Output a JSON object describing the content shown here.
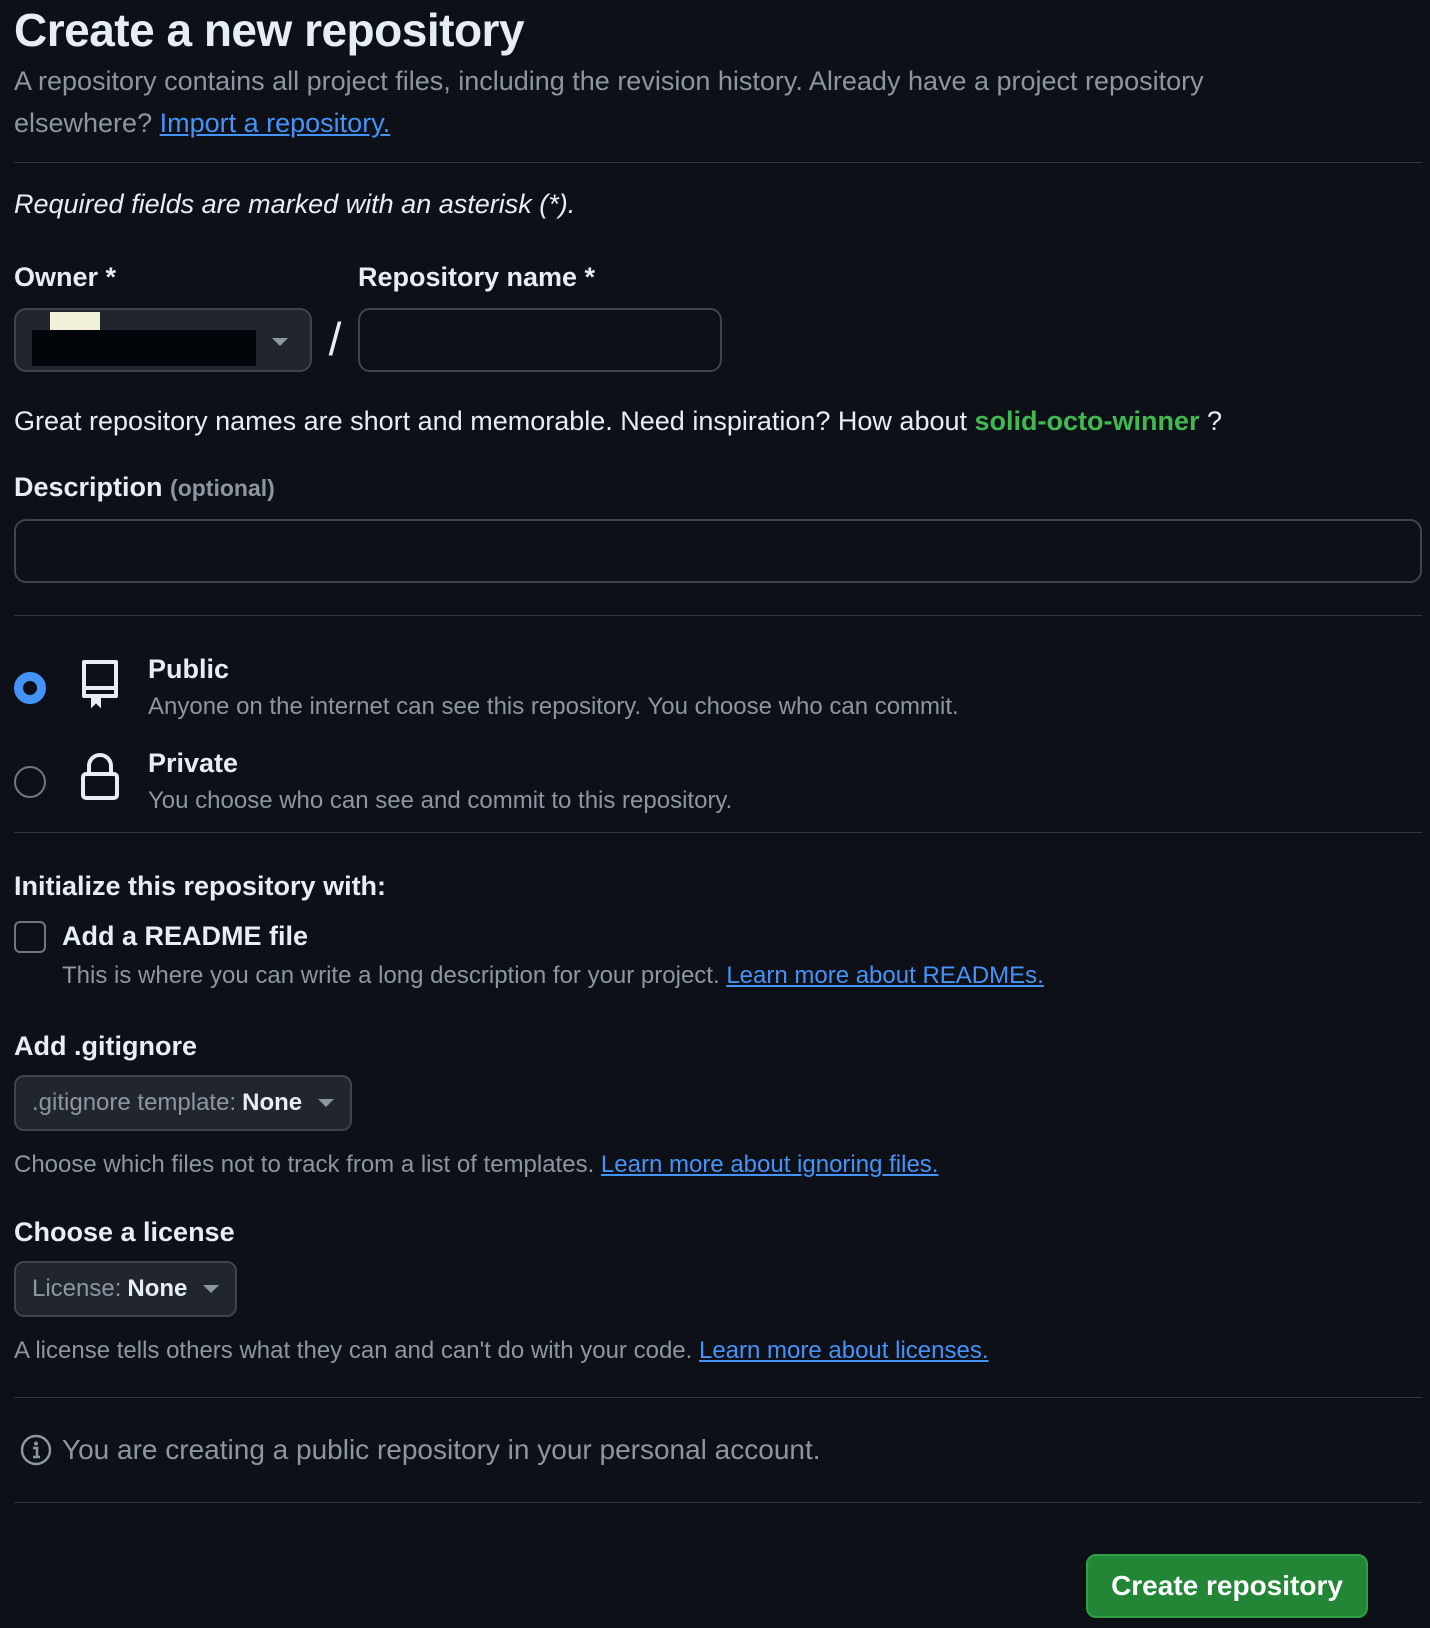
{
  "header": {
    "title": "Create a new repository",
    "subtitle_line1": "A repository contains all project files, including the revision history. Already have a project repository",
    "subtitle_line2": "elsewhere?",
    "import_link": "Import a repository."
  },
  "required_note": "Required fields are marked with an asterisk (*).",
  "owner": {
    "label": "Owner *",
    "icon": "chevron-down-icon"
  },
  "separator": "/",
  "repo_name": {
    "label": "Repository name *",
    "value": "",
    "placeholder": ""
  },
  "inspiration": {
    "text": "Great repository names are short and memorable. Need inspiration? How about",
    "suggestion": "solid-octo-winner",
    "end": "?"
  },
  "description": {
    "label": "Description",
    "optional": "(optional)",
    "value": ""
  },
  "visibility": [
    {
      "title": "Public",
      "desc": "Anyone on the internet can see this repository. You choose who can commit.",
      "icon": "repo-icon",
      "selected": true
    },
    {
      "title": "Private",
      "desc": "You choose who can see and commit to this repository.",
      "icon": "lock-icon",
      "selected": false
    }
  ],
  "initialize": {
    "label": "Initialize this repository with:",
    "readme_title": "Add a README file",
    "readme_desc": "This is where you can write a long description for your project.",
    "readme_link": "Learn more about READMEs.",
    "readme_checked": false
  },
  "gitignore": {
    "label": "Add .gitignore",
    "select_prefix": ".gitignore template:",
    "select_value": "None",
    "help": "Choose which files not to track from a list of templates.",
    "help_link": "Learn more about ignoring files."
  },
  "license": {
    "label": "Choose a license",
    "select_prefix": "License:",
    "select_value": "None",
    "help": "A license tells others what they can and can't do with your code.",
    "help_link": "Learn more about licenses."
  },
  "notice": {
    "icon": "info-icon",
    "text": "You are creating a public repository in your personal account."
  },
  "submit": {
    "label": "Create repository"
  },
  "colors": {
    "background": "#0d1117",
    "link": "#4493f8",
    "suggestion": "#3fb950",
    "primary_button": "#238636",
    "muted_text": "#8d96a0",
    "border": "#3d444d"
  }
}
